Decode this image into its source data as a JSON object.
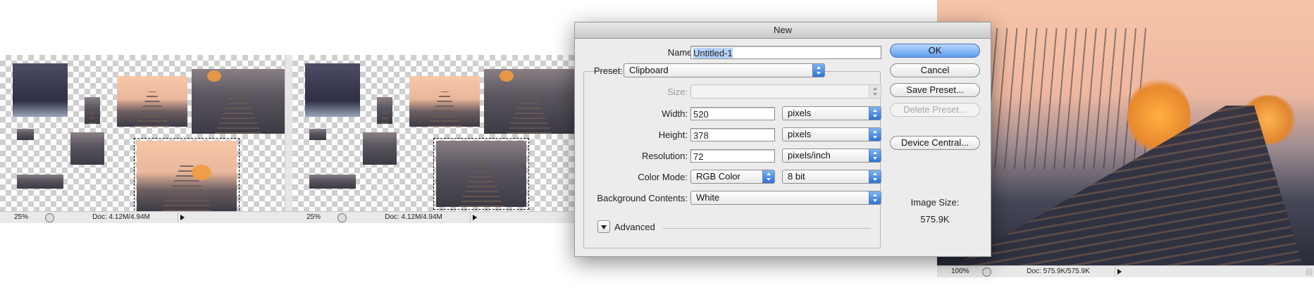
{
  "doc_windows": [
    {
      "zoom": "25%",
      "doc_info": "Doc: 4.12M/4.94M"
    },
    {
      "zoom": "25%",
      "doc_info": "Doc: 4.12M/4.94M"
    },
    {
      "zoom": "100%",
      "doc_info": "Doc: 575.9K/575.9K"
    }
  ],
  "dialog": {
    "title": "New",
    "name_label": "Name:",
    "name_value": "Untitled-1",
    "preset_label": "Preset:",
    "preset_value": "Clipboard",
    "size_label": "Size:",
    "size_value": "",
    "width_label": "Width:",
    "width_value": "520",
    "width_unit": "pixels",
    "height_label": "Height:",
    "height_value": "378",
    "height_unit": "pixels",
    "resolution_label": "Resolution:",
    "resolution_value": "72",
    "resolution_unit": "pixels/inch",
    "color_mode_label": "Color Mode:",
    "color_mode_value": "RGB Color",
    "bit_depth_value": "8 bit",
    "background_label": "Background Contents:",
    "background_value": "White",
    "advanced_label": "Advanced",
    "buttons": {
      "ok": "OK",
      "cancel": "Cancel",
      "save_preset": "Save Preset...",
      "delete_preset": "Delete Preset...",
      "device_central": "Device Central..."
    },
    "image_size_label": "Image Size:",
    "image_size_value": "575.9K"
  },
  "colors": {
    "accent_blue": "#5d9cf0",
    "dialog_bg": "#ececec",
    "photo_peach": "#f6c4a8",
    "foliage_orange": "#e8882f"
  }
}
